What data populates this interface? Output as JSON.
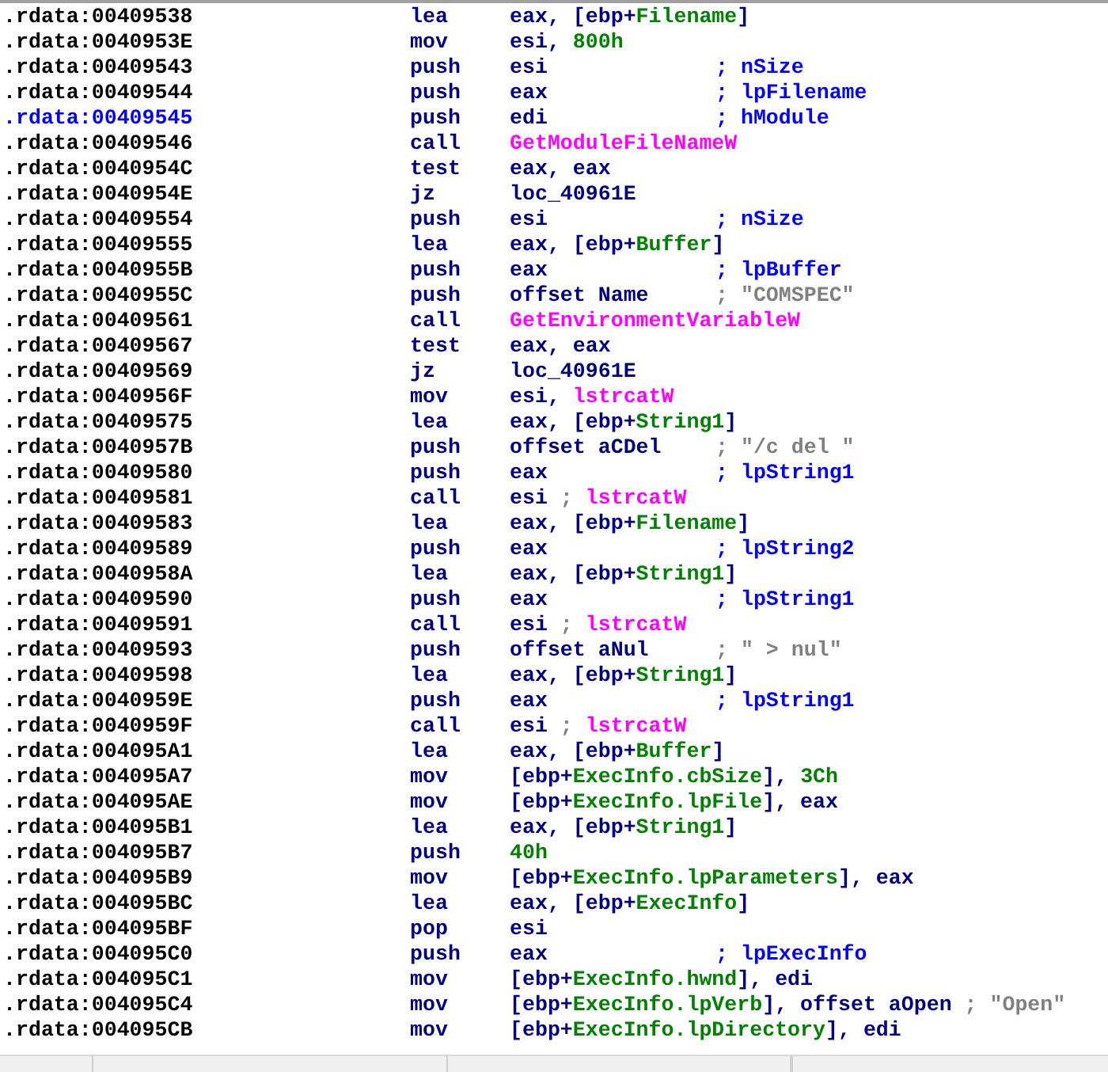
{
  "listing": [
    {
      "address": ".rdata:00409538",
      "selected": false,
      "mnemonic": "lea",
      "operands": [
        {
          "text": "eax, [ebp+",
          "kind": "plain"
        },
        {
          "text": "Filename",
          "kind": "var"
        },
        {
          "text": "]",
          "kind": "plain"
        }
      ]
    },
    {
      "address": ".rdata:0040953E",
      "selected": false,
      "mnemonic": "mov",
      "operands": [
        {
          "text": "esi, ",
          "kind": "plain"
        },
        {
          "text": "800h",
          "kind": "var"
        }
      ]
    },
    {
      "address": ".rdata:00409543",
      "selected": false,
      "mnemonic": "push",
      "operands": [
        {
          "text": "esi",
          "kind": "plain"
        }
      ],
      "comment": "; nSize"
    },
    {
      "address": ".rdata:00409544",
      "selected": false,
      "mnemonic": "push",
      "operands": [
        {
          "text": "eax",
          "kind": "plain"
        }
      ],
      "comment": "; lpFilename"
    },
    {
      "address": ".rdata:00409545",
      "selected": true,
      "mnemonic": "push",
      "operands": [
        {
          "text": "edi",
          "kind": "plain"
        }
      ],
      "comment": "; hModule"
    },
    {
      "address": ".rdata:00409546",
      "selected": false,
      "mnemonic": "call",
      "operands": [
        {
          "text": "GetModuleFileNameW",
          "kind": "func"
        }
      ]
    },
    {
      "address": ".rdata:0040954C",
      "selected": false,
      "mnemonic": "test",
      "operands": [
        {
          "text": "eax, eax",
          "kind": "plain"
        }
      ]
    },
    {
      "address": ".rdata:0040954E",
      "selected": false,
      "mnemonic": "jz",
      "operands": [
        {
          "text": "loc_40961E",
          "kind": "plain"
        }
      ]
    },
    {
      "address": ".rdata:00409554",
      "selected": false,
      "mnemonic": "push",
      "operands": [
        {
          "text": "esi",
          "kind": "plain"
        }
      ],
      "comment": "; nSize"
    },
    {
      "address": ".rdata:00409555",
      "selected": false,
      "mnemonic": "lea",
      "operands": [
        {
          "text": "eax, [ebp+",
          "kind": "plain"
        },
        {
          "text": "Buffer",
          "kind": "var"
        },
        {
          "text": "]",
          "kind": "plain"
        }
      ]
    },
    {
      "address": ".rdata:0040955B",
      "selected": false,
      "mnemonic": "push",
      "operands": [
        {
          "text": "eax",
          "kind": "plain"
        }
      ],
      "comment": "; lpBuffer"
    },
    {
      "address": ".rdata:0040955C",
      "selected": false,
      "mnemonic": "push",
      "operands": [
        {
          "text": "offset Name",
          "kind": "plain"
        }
      ],
      "comment": {
        "text": "; \"COMSPEC\"",
        "kind": "string"
      }
    },
    {
      "address": ".rdata:00409561",
      "selected": false,
      "mnemonic": "call",
      "operands": [
        {
          "text": "GetEnvironmentVariableW",
          "kind": "func"
        }
      ]
    },
    {
      "address": ".rdata:00409567",
      "selected": false,
      "mnemonic": "test",
      "operands": [
        {
          "text": "eax, eax",
          "kind": "plain"
        }
      ]
    },
    {
      "address": ".rdata:00409569",
      "selected": false,
      "mnemonic": "jz",
      "operands": [
        {
          "text": "loc_40961E",
          "kind": "plain"
        }
      ]
    },
    {
      "address": ".rdata:0040956F",
      "selected": false,
      "mnemonic": "mov",
      "operands": [
        {
          "text": "esi, ",
          "kind": "plain"
        },
        {
          "text": "lstrcatW",
          "kind": "func"
        }
      ]
    },
    {
      "address": ".rdata:00409575",
      "selected": false,
      "mnemonic": "lea",
      "operands": [
        {
          "text": "eax, [ebp+",
          "kind": "plain"
        },
        {
          "text": "String1",
          "kind": "var"
        },
        {
          "text": "]",
          "kind": "plain"
        }
      ]
    },
    {
      "address": ".rdata:0040957B",
      "selected": false,
      "mnemonic": "push",
      "operands": [
        {
          "text": "offset aCDel",
          "kind": "plain"
        }
      ],
      "comment": {
        "text": "; \"/c del \"",
        "kind": "string"
      }
    },
    {
      "address": ".rdata:00409580",
      "selected": false,
      "mnemonic": "push",
      "operands": [
        {
          "text": "eax",
          "kind": "plain"
        }
      ],
      "comment": "; lpString1"
    },
    {
      "address": ".rdata:00409581",
      "selected": false,
      "mnemonic": "call",
      "operands": [
        {
          "text": "esi ",
          "kind": "plain"
        },
        {
          "text": "; ",
          "kind": "string"
        },
        {
          "text": "lstrcatW",
          "kind": "func"
        }
      ]
    },
    {
      "address": ".rdata:00409583",
      "selected": false,
      "mnemonic": "lea",
      "operands": [
        {
          "text": "eax, [ebp+",
          "kind": "plain"
        },
        {
          "text": "Filename",
          "kind": "var"
        },
        {
          "text": "]",
          "kind": "plain"
        }
      ]
    },
    {
      "address": ".rdata:00409589",
      "selected": false,
      "mnemonic": "push",
      "operands": [
        {
          "text": "eax",
          "kind": "plain"
        }
      ],
      "comment": "; lpString2"
    },
    {
      "address": ".rdata:0040958A",
      "selected": false,
      "mnemonic": "lea",
      "operands": [
        {
          "text": "eax, [ebp+",
          "kind": "plain"
        },
        {
          "text": "String1",
          "kind": "var"
        },
        {
          "text": "]",
          "kind": "plain"
        }
      ]
    },
    {
      "address": ".rdata:00409590",
      "selected": false,
      "mnemonic": "push",
      "operands": [
        {
          "text": "eax",
          "kind": "plain"
        }
      ],
      "comment": "; lpString1"
    },
    {
      "address": ".rdata:00409591",
      "selected": false,
      "mnemonic": "call",
      "operands": [
        {
          "text": "esi ",
          "kind": "plain"
        },
        {
          "text": "; ",
          "kind": "string"
        },
        {
          "text": "lstrcatW",
          "kind": "func"
        }
      ]
    },
    {
      "address": ".rdata:00409593",
      "selected": false,
      "mnemonic": "push",
      "operands": [
        {
          "text": "offset aNul",
          "kind": "plain"
        }
      ],
      "comment": {
        "text": "; \" > nul\"",
        "kind": "string"
      }
    },
    {
      "address": ".rdata:00409598",
      "selected": false,
      "mnemonic": "lea",
      "operands": [
        {
          "text": "eax, [ebp+",
          "kind": "plain"
        },
        {
          "text": "String1",
          "kind": "var"
        },
        {
          "text": "]",
          "kind": "plain"
        }
      ]
    },
    {
      "address": ".rdata:0040959E",
      "selected": false,
      "mnemonic": "push",
      "operands": [
        {
          "text": "eax",
          "kind": "plain"
        }
      ],
      "comment": "; lpString1"
    },
    {
      "address": ".rdata:0040959F",
      "selected": false,
      "mnemonic": "call",
      "operands": [
        {
          "text": "esi ",
          "kind": "plain"
        },
        {
          "text": "; ",
          "kind": "string"
        },
        {
          "text": "lstrcatW",
          "kind": "func"
        }
      ]
    },
    {
      "address": ".rdata:004095A1",
      "selected": false,
      "mnemonic": "lea",
      "operands": [
        {
          "text": "eax, [ebp+",
          "kind": "plain"
        },
        {
          "text": "Buffer",
          "kind": "var"
        },
        {
          "text": "]",
          "kind": "plain"
        }
      ]
    },
    {
      "address": ".rdata:004095A7",
      "selected": false,
      "mnemonic": "mov",
      "operands": [
        {
          "text": "[ebp+",
          "kind": "plain"
        },
        {
          "text": "ExecInfo.cbSize",
          "kind": "var"
        },
        {
          "text": "], ",
          "kind": "plain"
        },
        {
          "text": "3Ch",
          "kind": "var"
        }
      ]
    },
    {
      "address": ".rdata:004095AE",
      "selected": false,
      "mnemonic": "mov",
      "operands": [
        {
          "text": "[ebp+",
          "kind": "plain"
        },
        {
          "text": "ExecInfo.lpFile",
          "kind": "var"
        },
        {
          "text": "], eax",
          "kind": "plain"
        }
      ]
    },
    {
      "address": ".rdata:004095B1",
      "selected": false,
      "mnemonic": "lea",
      "operands": [
        {
          "text": "eax, [ebp+",
          "kind": "plain"
        },
        {
          "text": "String1",
          "kind": "var"
        },
        {
          "text": "]",
          "kind": "plain"
        }
      ]
    },
    {
      "address": ".rdata:004095B7",
      "selected": false,
      "mnemonic": "push",
      "operands": [
        {
          "text": "40h",
          "kind": "var"
        }
      ]
    },
    {
      "address": ".rdata:004095B9",
      "selected": false,
      "mnemonic": "mov",
      "operands": [
        {
          "text": "[ebp+",
          "kind": "plain"
        },
        {
          "text": "ExecInfo.lpParameters",
          "kind": "var"
        },
        {
          "text": "], eax",
          "kind": "plain"
        }
      ]
    },
    {
      "address": ".rdata:004095BC",
      "selected": false,
      "mnemonic": "lea",
      "operands": [
        {
          "text": "eax, [ebp+",
          "kind": "plain"
        },
        {
          "text": "ExecInfo",
          "kind": "var"
        },
        {
          "text": "]",
          "kind": "plain"
        }
      ]
    },
    {
      "address": ".rdata:004095BF",
      "selected": false,
      "mnemonic": "pop",
      "operands": [
        {
          "text": "esi",
          "kind": "plain"
        }
      ]
    },
    {
      "address": ".rdata:004095C0",
      "selected": false,
      "mnemonic": "push",
      "operands": [
        {
          "text": "eax",
          "kind": "plain"
        }
      ],
      "comment": "; lpExecInfo"
    },
    {
      "address": ".rdata:004095C1",
      "selected": false,
      "mnemonic": "mov",
      "operands": [
        {
          "text": "[ebp+",
          "kind": "plain"
        },
        {
          "text": "ExecInfo.hwnd",
          "kind": "var"
        },
        {
          "text": "], edi",
          "kind": "plain"
        }
      ]
    },
    {
      "address": ".rdata:004095C4",
      "selected": false,
      "mnemonic": "mov",
      "operands": [
        {
          "text": "[ebp+",
          "kind": "plain"
        },
        {
          "text": "ExecInfo.lpVerb",
          "kind": "var"
        },
        {
          "text": "], offset aOpen ",
          "kind": "plain"
        },
        {
          "text": "; \"Open\"",
          "kind": "string"
        }
      ]
    },
    {
      "address": ".rdata:004095CB",
      "selected": false,
      "mnemonic": "mov",
      "operands": [
        {
          "text": "[ebp+",
          "kind": "plain"
        },
        {
          "text": "ExecInfo.lpDirectory",
          "kind": "var"
        },
        {
          "text": "], edi",
          "kind": "plain"
        }
      ]
    }
  ]
}
